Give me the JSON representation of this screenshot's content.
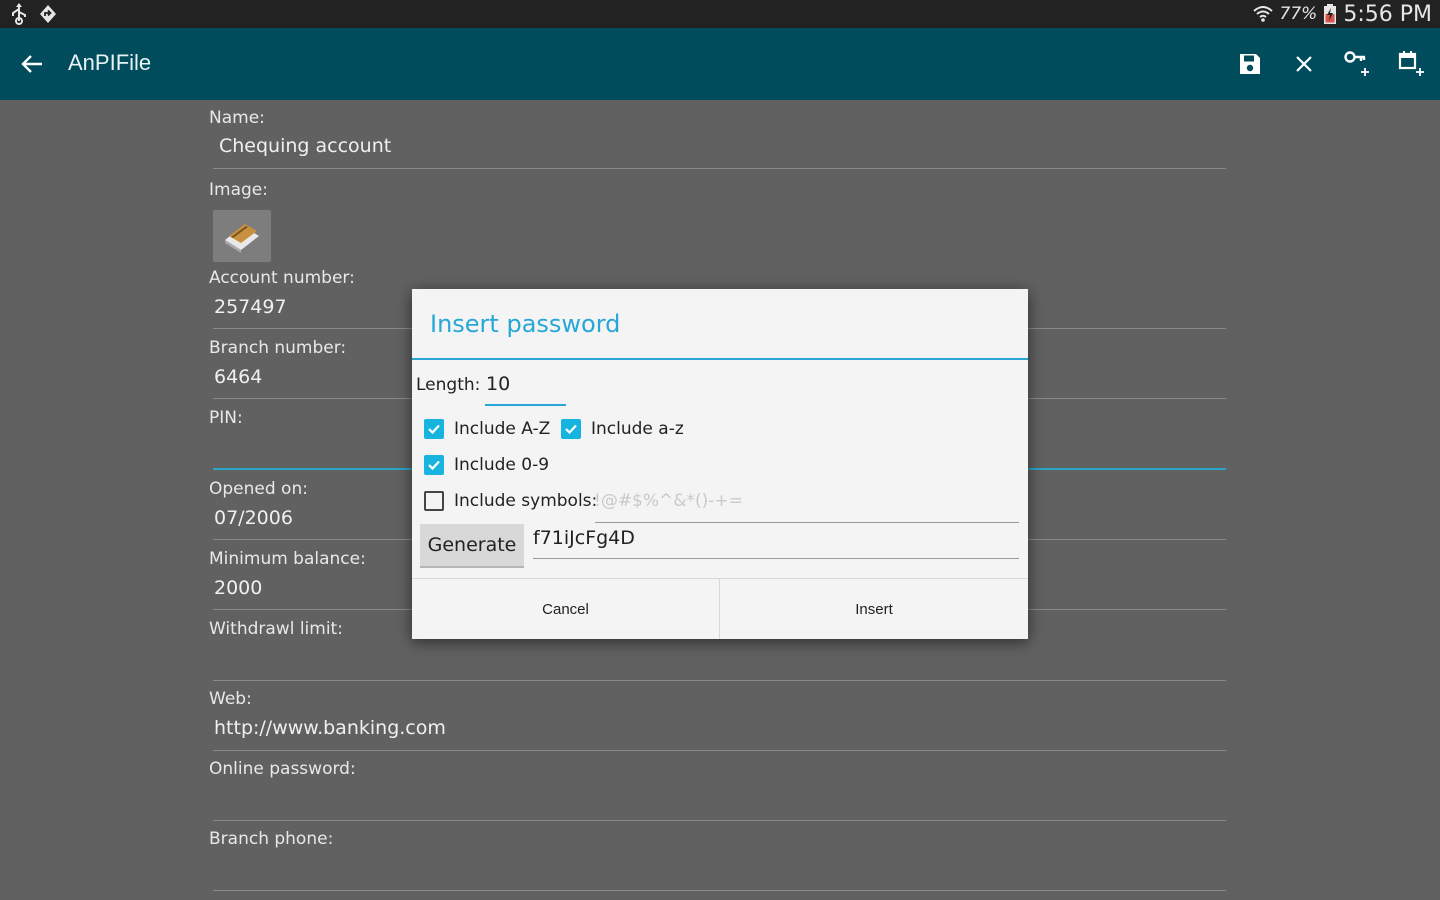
{
  "status_bar": {
    "left_icons": [
      "usb-icon",
      "notification-icon"
    ],
    "battery_pct": "77%",
    "time": "5:56 PM"
  },
  "action_bar": {
    "title": "AnPIFile",
    "actions": [
      "save-icon",
      "close-icon",
      "add-password-icon",
      "add-date-icon"
    ],
    "color": "#004c5c"
  },
  "form": {
    "name_label": "Name:",
    "name_value": "Chequing account",
    "image_label": "Image:",
    "account_label": "Account number:",
    "account_value": "257497",
    "branch_label": "Branch number:",
    "branch_value": "6464",
    "pin_label": "PIN:",
    "opened_label": "Opened on:",
    "opened_value": "07/2006",
    "min_balance_label": "Minimum balance:",
    "min_balance_value": "2000",
    "withdrawl_label": "Withdrawl limit:",
    "web_label": "Web:",
    "web_value": "http://www.banking.com",
    "online_password_label": "Online password:",
    "branch_phone_label": "Branch phone:"
  },
  "dialog": {
    "title": "Insert password",
    "length_label": "Length:",
    "length_value": "10",
    "include_upper_label": "Include A-Z",
    "include_lower_label": "Include a-z",
    "include_digits_label": "Include 0-9",
    "include_symbols_label": "Include symbols:",
    "symbols_placeholder": "!@#$%^&*()-+=",
    "generate_label": "Generate",
    "generated_value": "f71iJcFg4D",
    "cancel_label": "Cancel",
    "insert_label": "Insert",
    "accent": "#26a7d6"
  }
}
